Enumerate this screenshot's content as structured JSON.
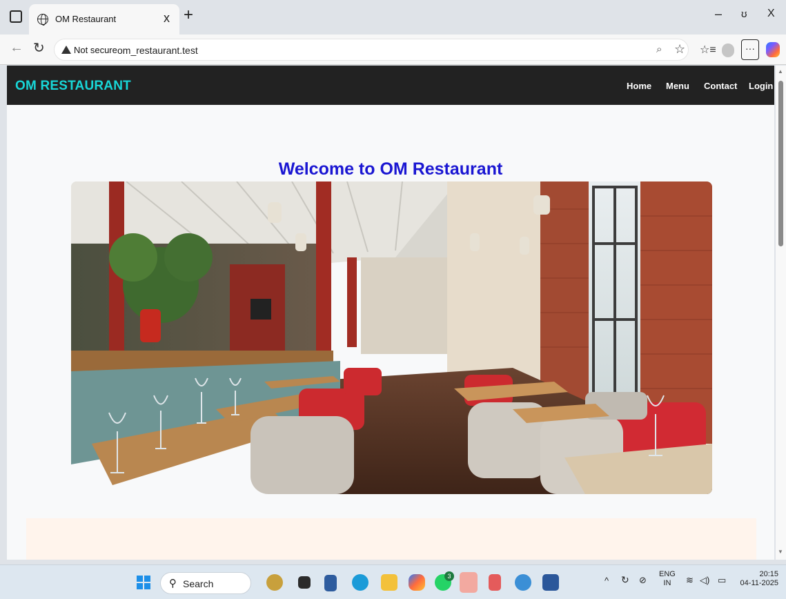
{
  "browser": {
    "tab_title": "OM Restaurant",
    "tab_close": "x",
    "new_tab": "+",
    "minimize": "–",
    "restore": "ʊ",
    "close": "X",
    "security_label": "Not secure",
    "url": "om_restaurant.test",
    "more_label": "···"
  },
  "site": {
    "brand": "OM RESTAURANT",
    "menu": [
      {
        "label": "Home"
      },
      {
        "label": "Menu"
      },
      {
        "label": "Contact"
      },
      {
        "label": "Login"
      }
    ],
    "hero_heading": "Welcome to OM Restaurant"
  },
  "taskbar": {
    "search_label": "Search",
    "language": "ENG",
    "region": "IN",
    "time": "20:15",
    "date": "04-11-2025",
    "whatsapp_badge": "3"
  },
  "colors": {
    "navbar_bg": "#222222",
    "brand_color": "#18d7d8",
    "heading_color": "#1a16d2",
    "cream_section": "#fff4ec"
  },
  "icons": [
    "tab-panel-icon",
    "globe-icon",
    "back-icon",
    "reload-icon",
    "warning-icon",
    "zoom-icon",
    "star-icon",
    "favorites-icon",
    "profile-icon",
    "copilot-icon",
    "windows-start-icon",
    "search-icon"
  ]
}
